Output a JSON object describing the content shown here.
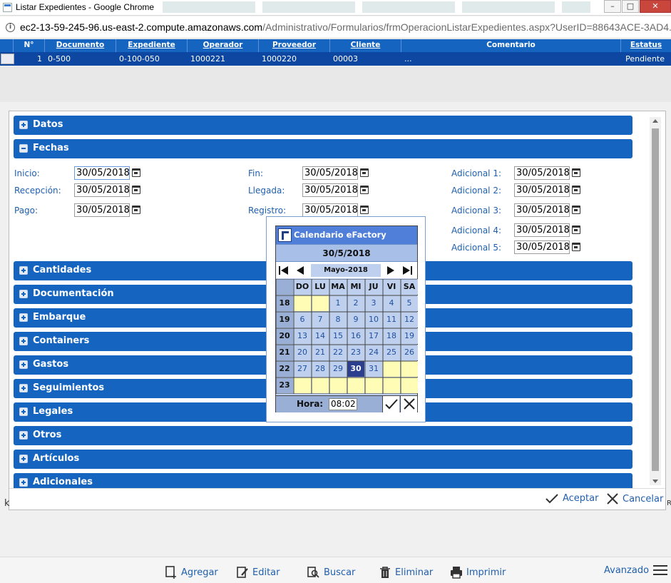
{
  "window": {
    "title": "Listar Expedientes - Google Chrome",
    "url_host": "ec2-13-59-245-96.us-east-2.compute.amazonaws.com",
    "url_path": "/Administrativo/Formularios/frmOperacionListarExpedientes.aspx?UserID=88643ACE-3AD4..."
  },
  "grid": {
    "headers": [
      "N°",
      "Documento",
      "Expediente",
      "Operador",
      "Proveedor",
      "Cliente",
      "Comentario",
      "Estatus"
    ],
    "row": {
      "num": "1",
      "documento": "0-500",
      "expediente": "0-100-050",
      "operador": "1000221",
      "proveedor": "1000220",
      "cliente": "00003",
      "comentario": "...",
      "estatus": "Pendiente"
    }
  },
  "sections": {
    "datos": "Datos",
    "fechas": "Fechas",
    "cantidades": "Cantidades",
    "documentacion": "Documentación",
    "embarque": "Embarque",
    "containers": "Containers",
    "gastos": "Gastos",
    "seguimientos": "Seguimientos",
    "legales": "Legales",
    "otros": "Otros",
    "articulos": "Artículos",
    "adicionales": "Adicionales"
  },
  "fechas": {
    "inicio_label": "Inicio:",
    "inicio": "30/05/2018",
    "recepcion_label": "Recepción:",
    "recepcion": "30/05/2018",
    "pago_label": "Pago:",
    "pago": "30/05/2018",
    "fin_label": "Fin:",
    "fin": "30/05/2018",
    "llegada_label": "Llegada:",
    "llegada": "30/05/2018",
    "registro_label": "Registro:",
    "registro": "30/05/2018",
    "adicional1_label": "Adicional 1:",
    "adicional1": "30/05/2018",
    "adicional2_label": "Adicional 2:",
    "adicional2": "30/05/2018",
    "adicional3_label": "Adicional 3:",
    "adicional3": "30/05/2018",
    "adicional4_label": "Adicional 4:",
    "adicional4": "30/05/2018",
    "adicional5_label": "Adicional 5:",
    "adicional5": "30/05/2018"
  },
  "calendar": {
    "title": "Calendario eFactory",
    "selected_date": "30/5/2018",
    "month_label": "Mayo-2018",
    "weekdays": [
      "DO",
      "LU",
      "MA",
      "MI",
      "JU",
      "VI",
      "SA"
    ],
    "weeks": [
      {
        "num": "18",
        "days": [
          "",
          "",
          "1",
          "2",
          "3",
          "4",
          "5"
        ]
      },
      {
        "num": "19",
        "days": [
          "6",
          "7",
          "8",
          "9",
          "10",
          "11",
          "12"
        ]
      },
      {
        "num": "20",
        "days": [
          "13",
          "14",
          "15",
          "16",
          "17",
          "18",
          "19"
        ]
      },
      {
        "num": "21",
        "days": [
          "20",
          "21",
          "22",
          "23",
          "24",
          "25",
          "26"
        ]
      },
      {
        "num": "22",
        "days": [
          "27",
          "28",
          "29",
          "30",
          "31",
          "",
          ""
        ]
      },
      {
        "num": "23",
        "days": [
          "",
          "",
          "",
          "",
          "",
          "",
          ""
        ]
      }
    ],
    "selected_day": "30",
    "time_label": "Hora:",
    "time_value": "08:02"
  },
  "modal_footer": {
    "accept": "Aceptar",
    "cancel": "Cancelar"
  },
  "toolbar": {
    "add": "Agregar",
    "edit": "Editar",
    "search": "Buscar",
    "delete": "Eliminar",
    "print": "Imprimir",
    "advanced": "Avanzado"
  },
  "colors": {
    "primary": "#1565c0",
    "row_selected": "#0d47a1",
    "calendar_header": "#4f7fd8",
    "calendar_day": "#bed0ee",
    "calendar_empty": "#fffdb5",
    "calendar_selected": "#2b3f8e"
  }
}
